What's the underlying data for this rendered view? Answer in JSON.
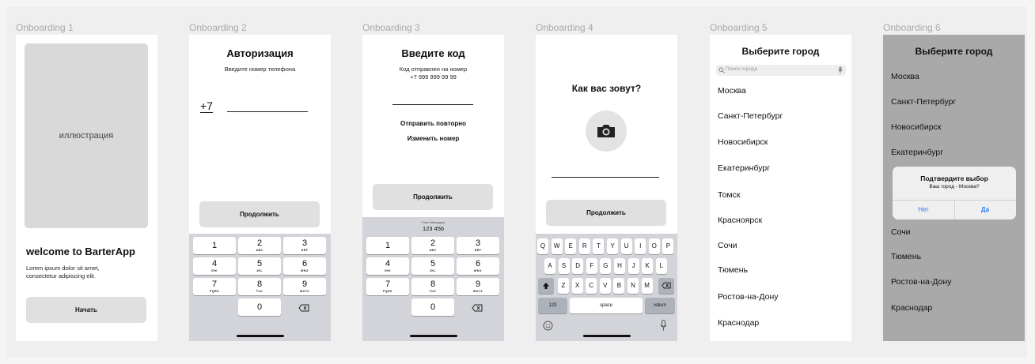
{
  "frames": [
    {
      "label": "Onboarding 1"
    },
    {
      "label": "Onboarding 2"
    },
    {
      "label": "Onboarding 3"
    },
    {
      "label": "Onboarding 4"
    },
    {
      "label": "Onboarding 5"
    },
    {
      "label": "Onboarding 6"
    }
  ],
  "s1": {
    "illustration": "иллюстрация",
    "welcome": "welcome to BarterApp",
    "lorem1": "Lorem ipsum dolor sit amet,",
    "lorem2": "consectetur adipiscing elit.",
    "start": "Начать"
  },
  "s2": {
    "title": "Авторизация",
    "sub": "Введите номер телефона",
    "prefix": "+7",
    "continue": "Продолжить"
  },
  "s3": {
    "title": "Введите код",
    "sub1": "Код отправлен на номер",
    "sub2": "+7 999 999 99 99",
    "resend": "Отправить повторно",
    "change": "Изменить номер",
    "continue": "Продолжить",
    "from_messages": "From Messages",
    "code": "123 456"
  },
  "keys": [
    {
      "d": "1",
      "l": ""
    },
    {
      "d": "2",
      "l": "ABC"
    },
    {
      "d": "3",
      "l": "DEF"
    },
    {
      "d": "4",
      "l": "GHI"
    },
    {
      "d": "5",
      "l": "JKL"
    },
    {
      "d": "6",
      "l": "MNO"
    },
    {
      "d": "7",
      "l": "PQRS"
    },
    {
      "d": "8",
      "l": "TUV"
    },
    {
      "d": "9",
      "l": "WXYZ"
    },
    {
      "d": "0",
      "l": ""
    }
  ],
  "s4": {
    "title": "Как вас зовут?",
    "continue": "Продолжить",
    "row1": [
      "Q",
      "W",
      "E",
      "R",
      "T",
      "Y",
      "U",
      "I",
      "O",
      "P"
    ],
    "row2": [
      "A",
      "S",
      "D",
      "F",
      "G",
      "H",
      "J",
      "K",
      "L"
    ],
    "row3": [
      "Z",
      "X",
      "C",
      "V",
      "B",
      "N",
      "M"
    ],
    "k123": "123",
    "space": "space",
    "ret": "return",
    "camera_icon": "camera-icon"
  },
  "s5": {
    "title": "Выберите город",
    "search_placeholder": "Поиск города",
    "cities": [
      "Москва",
      "Санкт-Петербург",
      "Новосибирск",
      "Екатеринбург",
      "Томск",
      "Красноярск",
      "Сочи",
      "Тюмень",
      "Ростов-на-Дону",
      "Краснодар"
    ]
  },
  "s6": {
    "title": "Выберите город",
    "cities": [
      "Москва",
      "Санкт-Петербург",
      "Новосибирск",
      "Екатеринбург",
      "Сочи",
      "Тюмень",
      "Ростов-на-Дону",
      "Краснодар"
    ],
    "dialog_title": "Подтвердите выбор",
    "dialog_sub": "Ваш город - Москва?",
    "no": "Нет",
    "yes": "Да"
  },
  "colors": {
    "overlay": "#a9a9a9",
    "ios_blue": "#2f7cf6",
    "keyboard": "#d2d4d9"
  }
}
